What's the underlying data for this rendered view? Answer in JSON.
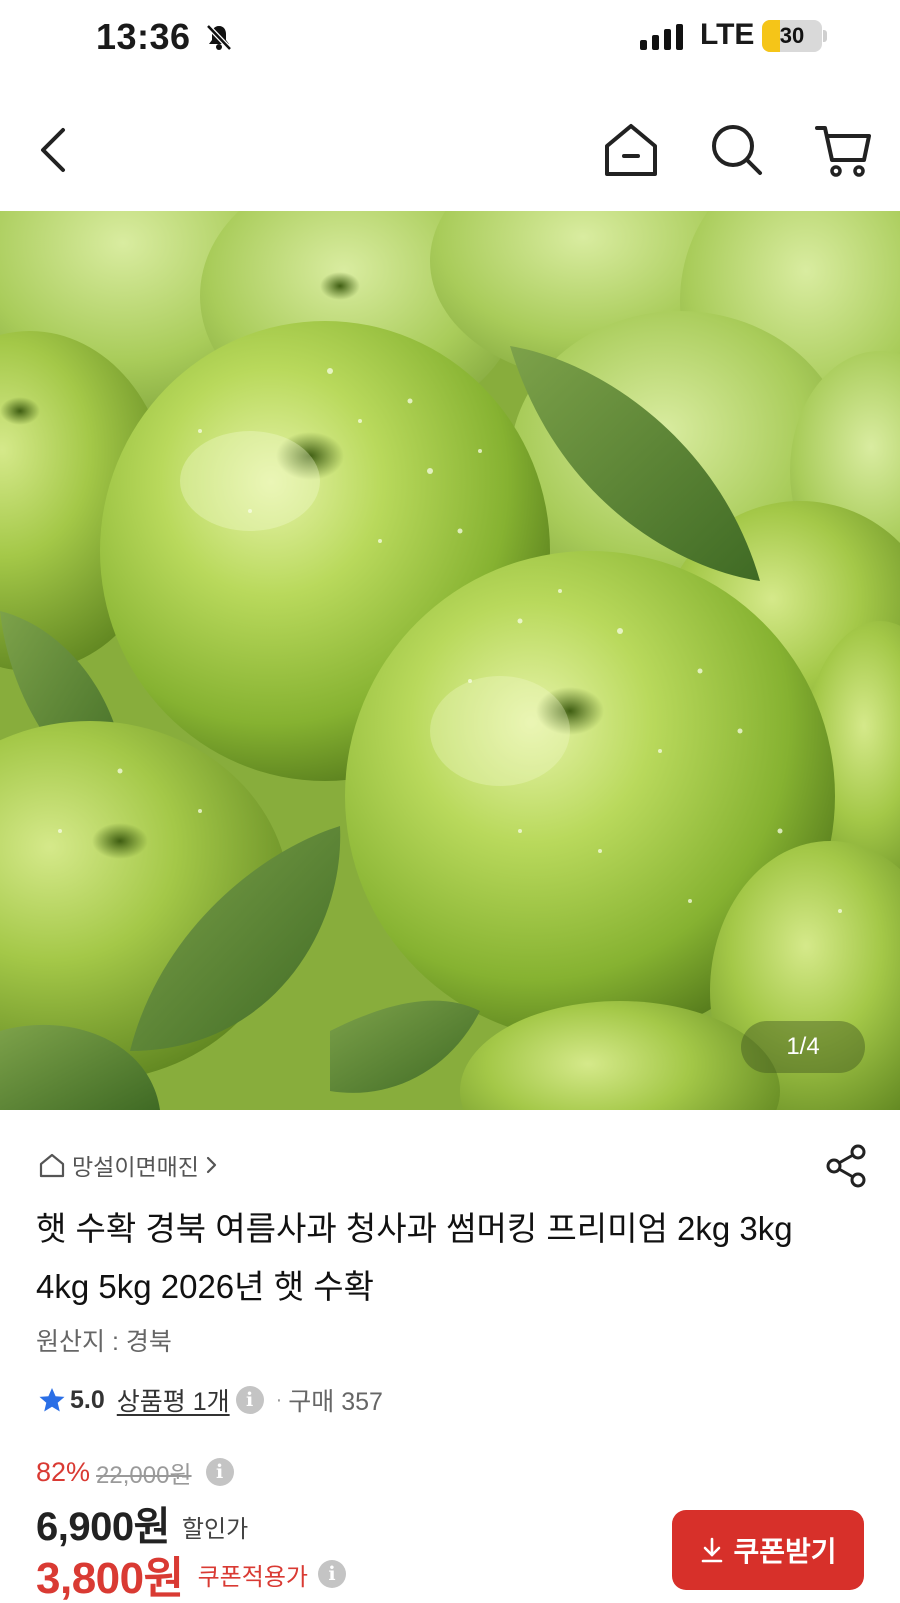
{
  "status_bar": {
    "time": "13:36",
    "network": "LTE",
    "battery": "30",
    "battery_level": 0.3,
    "accent_color": "#f5c518"
  },
  "nav": {
    "back_icon": "chevron-left-icon",
    "home_icon": "home-icon",
    "search_icon": "search-icon",
    "cart_icon": "cart-icon"
  },
  "gallery": {
    "counter": "1/4"
  },
  "product": {
    "seller": "망설이면매진",
    "title": "햇 수확 경북 여름사과 청사과 썸머킹 프리미엄 2kg 3kg 4kg 5kg 2026년 햇 수확",
    "origin": "원산지 : 경북",
    "rating": "5.0",
    "review_link": "상품평 1개",
    "purchase_count": "구매 357",
    "separator": "·"
  },
  "price": {
    "discount_rate": "82%",
    "original_price": "22,000원",
    "sale_price": "6,900원",
    "sale_label": "할인가",
    "coupon_price": "3,800원",
    "coupon_label": "쿠폰적용가",
    "info_glyph": "i"
  },
  "coupon_button": {
    "label": "쿠폰받기"
  },
  "colors": {
    "brand_red": "#d7302a",
    "star_blue": "#2b6fe6"
  }
}
